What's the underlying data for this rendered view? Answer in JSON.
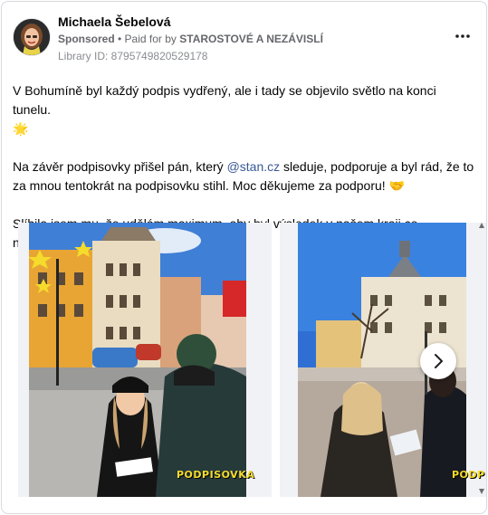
{
  "post": {
    "author_name": "Michaela Šebelová",
    "sponsored_label": "Sponsored",
    "separator": " • ",
    "paid_for_prefix": "Paid for by ",
    "payer": "STAROSTOVÉ A NEZÁVISLÍ",
    "library_id": "Library ID: 8795749820529178",
    "more_icon": "more-horizontal-icon"
  },
  "text": {
    "p1": "V Bohumíně byl každý podpis vydřený, ale i tady se objevilo světlo na konci tunelu.",
    "p1_emoji": "🌟",
    "p2_before": "Na závěr podpisovky přišel pán, který ",
    "p2_mention": "@stan.cz",
    "p2_after": " sleduje, podporuje a byl rád, že to za mnou tentokrát na podpisovku stihl. Moc děkujeme za podporu!",
    "p2_emoji": "🤝",
    "p3": "Slíbila jsem mu, že udělám maximum, aby byl výsledek v našem kraji co nejlepší...."
  },
  "carousel": {
    "slides": [
      {
        "overlay_text": "PODPISOVKA"
      },
      {
        "overlay_text": "PODP"
      }
    ],
    "next_icon": "chevron-right-icon"
  },
  "colors": {
    "accent_link": "#385898",
    "meta_gray": "#65676b",
    "overlay_yellow": "#f5dc2c"
  }
}
